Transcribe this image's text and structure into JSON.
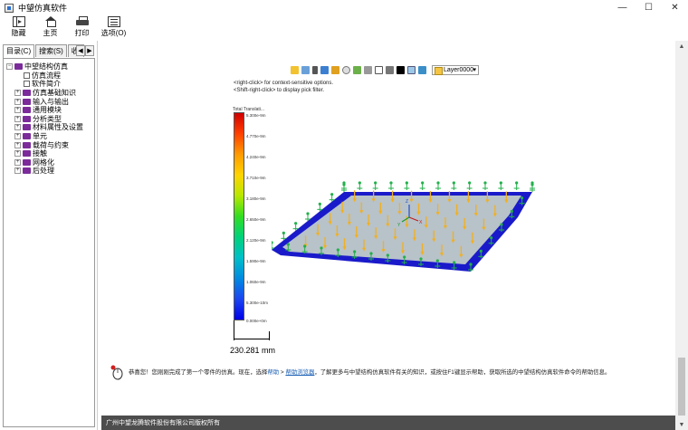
{
  "window": {
    "title": "中望仿真软件",
    "minimize": "—",
    "maximize": "☐",
    "close": "✕"
  },
  "toolbar": {
    "hide_label": "隐藏",
    "home_label": "主页",
    "print_label": "打印",
    "options_label": "选项(O)"
  },
  "nav": {
    "tabs": [
      "目录(C)",
      "搜索(S)",
      "收"
    ],
    "prev": "◀",
    "next": "▶",
    "tree": {
      "root": "中望结构仿真",
      "items": [
        {
          "label": "仿真流程",
          "type": "page"
        },
        {
          "label": "软件简介",
          "type": "page"
        },
        {
          "label": "仿真基础知识",
          "type": "book"
        },
        {
          "label": "输入与输出",
          "type": "book"
        },
        {
          "label": "通用模块",
          "type": "book"
        },
        {
          "label": "分析类型",
          "type": "book"
        },
        {
          "label": "材料属性及设置",
          "type": "book"
        },
        {
          "label": "单元",
          "type": "book"
        },
        {
          "label": "载荷与约束",
          "type": "book"
        },
        {
          "label": "接触",
          "type": "book"
        },
        {
          "label": "网格化",
          "type": "book"
        },
        {
          "label": "后处理",
          "type": "book"
        }
      ]
    }
  },
  "viewport": {
    "layer": "Layer0000",
    "hint_right_click": "<right-click> for context-sensitive options.",
    "hint_shift_right_click": "<Shift-right-click> to display pick filter.",
    "legend_title": "Total Translati...",
    "legend_ticks": [
      "5.300e-9m",
      "4.770e-9m",
      "4.240e-9m",
      "3.710e-9m",
      "3.180e-9m",
      "2.650e-9m",
      "2.120e-9m",
      "1.590e-9m",
      "1.060e-9m",
      "5.300e-10m",
      "0.000e+0m"
    ],
    "scale": "230.281 mm",
    "axis_x": "X",
    "axis_y": "Y",
    "axis_z": "Z"
  },
  "message": {
    "prefix": "恭喜您！您刚刚完成了第一个零件的仿真。现在，选择",
    "link_help": "帮助",
    "separator": " > ",
    "link_browser": "帮助浏览器",
    "suffix": "，了解更多与中望结构仿真软件有关的知识，或按住F1键显示帮助，获取所选的中望结构仿真软件命令的帮助信息。"
  },
  "footer": {
    "copyright": "广州中望龙腾软件股份有限公司版权所有"
  },
  "scrollbar": {
    "up": "▲",
    "down": "▼"
  },
  "colors": {
    "plate": "#b8c2c9",
    "plate_border": "#1a1acb",
    "arrow": "#f2b01e",
    "constraint": "#22b04a"
  }
}
